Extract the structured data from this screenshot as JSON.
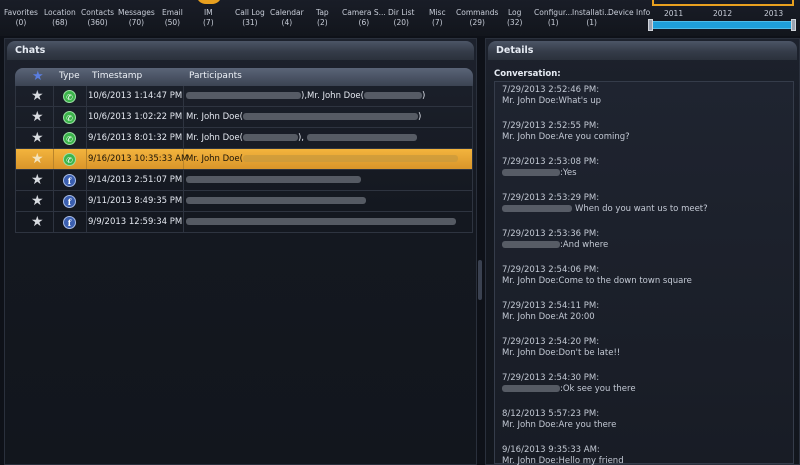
{
  "topbar": {
    "categories": [
      {
        "name": "Favorites",
        "count": "(0)"
      },
      {
        "name": "Location",
        "count": "(68)"
      },
      {
        "name": "Contacts",
        "count": "(360)"
      },
      {
        "name": "Messages",
        "count": "(70)"
      },
      {
        "name": "Email",
        "count": "(50)"
      },
      {
        "name": "IM",
        "count": "(7)"
      },
      {
        "name": "Call Log",
        "count": "(31)"
      },
      {
        "name": "Calendar",
        "count": "(4)"
      },
      {
        "name": "Tap",
        "count": "(2)"
      },
      {
        "name": "Camera S...",
        "count": "(6)"
      },
      {
        "name": "Dir List",
        "count": "(20)"
      },
      {
        "name": "Misc",
        "count": "(7)"
      },
      {
        "name": "Commands",
        "count": "(29)"
      },
      {
        "name": "Log",
        "count": "(32)"
      },
      {
        "name": "Configur...",
        "count": "(1)"
      },
      {
        "name": "Installati...",
        "count": "(1)"
      },
      {
        "name": "Device Info",
        "count": ""
      }
    ],
    "timeline_years": [
      "2011",
      "2012",
      "2013"
    ]
  },
  "chats": {
    "title": "Chats",
    "columns": {
      "type": "Type",
      "timestamp": "Timestamp",
      "participants": "Participants"
    },
    "rows": [
      {
        "type": "whatsapp",
        "timestamp": "10/6/2013 1:14:47 PM",
        "participants": "),Mr. John Doe(",
        "tail": ")",
        "selected": false
      },
      {
        "type": "whatsapp",
        "timestamp": "10/6/2013 1:02:22 PM",
        "participants": "Mr. John Doe(",
        "tail": ")",
        "selected": false
      },
      {
        "type": "whatsapp",
        "timestamp": "9/16/2013 8:01:32 PM",
        "participants": "Mr. John Doe(",
        "tail": "),",
        "selected": false
      },
      {
        "type": "whatsapp",
        "timestamp": "9/16/2013 10:35:33 AM",
        "participants": "Mr. John Doe(",
        "tail": "",
        "selected": true
      },
      {
        "type": "facebook",
        "timestamp": "9/14/2013 2:51:07 PM",
        "participants": "",
        "tail": "",
        "selected": false
      },
      {
        "type": "facebook",
        "timestamp": "9/11/2013 8:49:35 PM",
        "participants": "",
        "tail": "",
        "selected": false
      },
      {
        "type": "facebook",
        "timestamp": "9/9/2013 12:59:34 PM",
        "participants": "",
        "tail": "",
        "selected": false
      }
    ]
  },
  "details": {
    "title": "Details",
    "conversation_label": "Conversation:",
    "messages": [
      {
        "ts": "7/29/2013 2:52:46 PM:",
        "body": "Mr. John Doe:What's up"
      },
      {
        "ts": "7/29/2013 2:52:55 PM:",
        "body": "Mr. John Doe:Are you coming?"
      },
      {
        "ts": "7/29/2013 2:53:08 PM:",
        "body": ":Yes"
      },
      {
        "ts": "7/29/2013 2:53:29 PM:",
        "body": "When do you want us to meet?"
      },
      {
        "ts": "7/29/2013 2:53:36 PM:",
        "body": ":And where"
      },
      {
        "ts": "7/29/2013 2:54:06 PM:",
        "body": "Mr. John Doe:Come to the down town square"
      },
      {
        "ts": "7/29/2013 2:54:11 PM:",
        "body": "Mr. John Doe:At 20:00"
      },
      {
        "ts": "7/29/2013 2:54:20 PM:",
        "body": "Mr. John Doe:Don't be late!!"
      },
      {
        "ts": "7/29/2013 2:54:30 PM:",
        "body": ":Ok see you there"
      },
      {
        "ts": "8/12/2013 5:57:23 PM:",
        "body": "Mr. John Doe:Are you there"
      },
      {
        "ts": "9/16/2013 9:35:33 AM:",
        "body": "Mr. John Doe:Hello my friend"
      }
    ]
  },
  "colors": {
    "accent": "#e8a01f",
    "selection": "#f3b43d",
    "timeline": "#1e9ed9"
  }
}
